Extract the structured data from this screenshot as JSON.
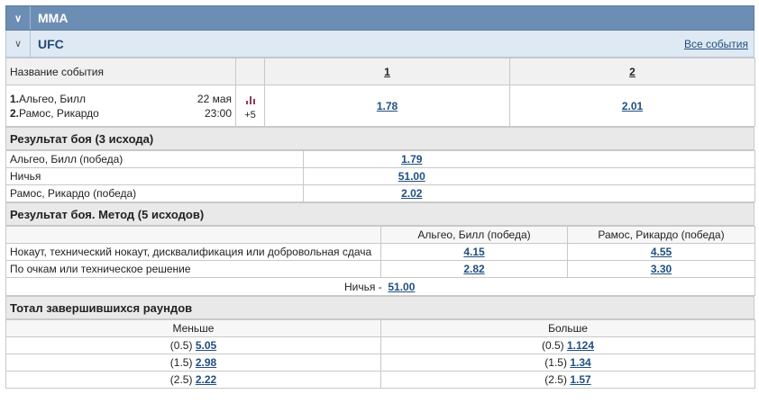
{
  "sport": {
    "title": "MMA"
  },
  "league": {
    "title": "UFC",
    "all_events": "Все события"
  },
  "header": {
    "event_name_label": "Название события",
    "col1": "1",
    "col2": "2"
  },
  "event": {
    "team1_num": "1.",
    "team1": "Альгео, Билл",
    "team2_num": "2.",
    "team2": "Рамос, Рикардо",
    "date": "22 мая",
    "time": "23:00",
    "more": "+5",
    "odd1": "1.78",
    "odd2": "2.01"
  },
  "result": {
    "title": "Результат боя (3 исхода)",
    "rows": [
      {
        "label": "Альгео, Билл (победа)",
        "odd": "1.79"
      },
      {
        "label": "Ничья",
        "odd": "51.00"
      },
      {
        "label": "Рамос, Рикардо (победа)",
        "odd": "2.02"
      }
    ]
  },
  "method": {
    "title": "Результат боя. Метод (5 исходов)",
    "col_a": "Альгео, Билл (победа)",
    "col_b": "Рамос, Рикардо (победа)",
    "rows": [
      {
        "label": "Нокаут, технический нокаут, дисквалификация или добровольная сдача",
        "a": "4.15",
        "b": "4.55"
      },
      {
        "label": "По очкам или техническое решение",
        "a": "2.82",
        "b": "3.30"
      }
    ],
    "draw_label": "Ничья -",
    "draw_odd": "51.00"
  },
  "total": {
    "title": "Тотал завершившихся раундов",
    "under_label": "Меньше",
    "over_label": "Больше",
    "rows": [
      {
        "u_line": "(0.5)",
        "u_odd": "5.05",
        "o_line": "(0.5)",
        "o_odd": "1.124"
      },
      {
        "u_line": "(1.5)",
        "u_odd": "2.98",
        "o_line": "(1.5)",
        "o_odd": "1.34"
      },
      {
        "u_line": "(2.5)",
        "u_odd": "2.22",
        "o_line": "(2.5)",
        "o_odd": "1.57"
      }
    ]
  },
  "colors": {
    "sport_bar": "#6d8eb4",
    "league_bar": "#dfe9f3",
    "link": "#1f4f80",
    "stats_icon": "#8a3f53"
  },
  "icons": {
    "collapse": "chevron-down-icon",
    "stats": "bar-chart-icon"
  }
}
